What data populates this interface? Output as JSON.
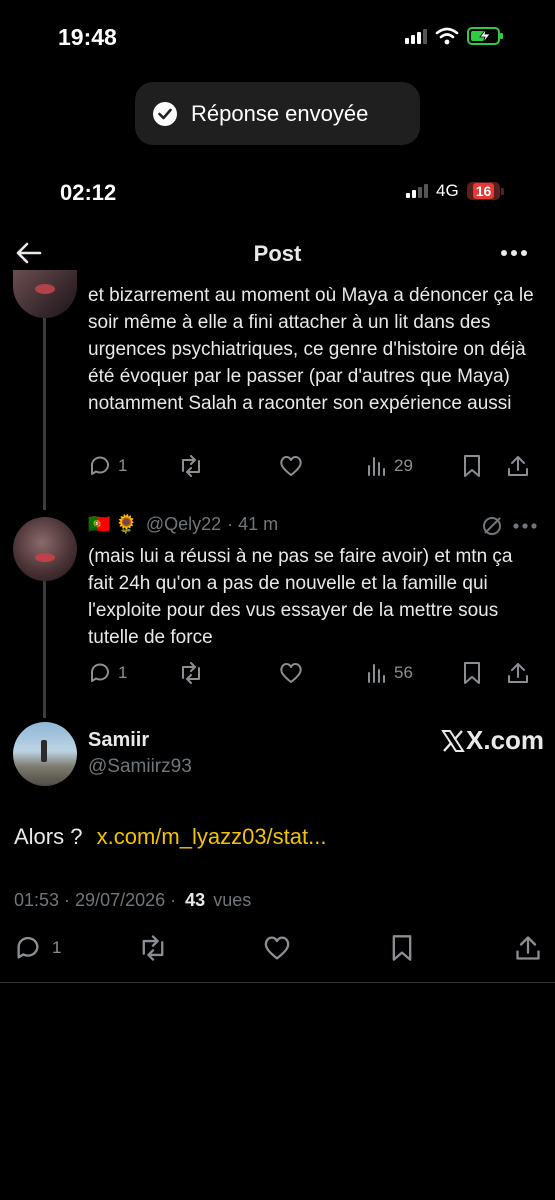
{
  "status_bar_top": {
    "time": "19:48"
  },
  "toast": {
    "text": "Réponse envoyée"
  },
  "status_bar_inner": {
    "time": "02:12",
    "network": "4G",
    "battery": "16"
  },
  "header": {
    "title": "Post"
  },
  "reply1": {
    "text": "et bizarrement au moment où Maya a dénoncer ça le soir même à elle a fini attacher à un lit dans des urgences psychiatriques, ce genre d'histoire on déjà été évoquer par le passer (par d'autres que Maya) notamment Salah a raconter son expérience aussi",
    "replies": "1",
    "views": "29"
  },
  "reply2": {
    "flags": "🇵🇹 🌻",
    "handle": "@Qely22",
    "time": "· 41 m",
    "text": "(mais lui a réussi à ne pas se faire avoir) et mtn ça fait 24h qu'on a pas de nouvelle et la famille qui l'exploite pour des vus essayer de la mettre sous tutelle de force",
    "replies": "1",
    "views": "56"
  },
  "main": {
    "name": "Samiir",
    "handle": "@Samiirz93",
    "watermark": "X.com",
    "text": "Alors ?",
    "link": "x.com/m_lyazz03/stat...",
    "timestamp": "01:53 · 29/07/2026 ·",
    "views_count": "43",
    "views_label": "vues",
    "replies": "1"
  }
}
